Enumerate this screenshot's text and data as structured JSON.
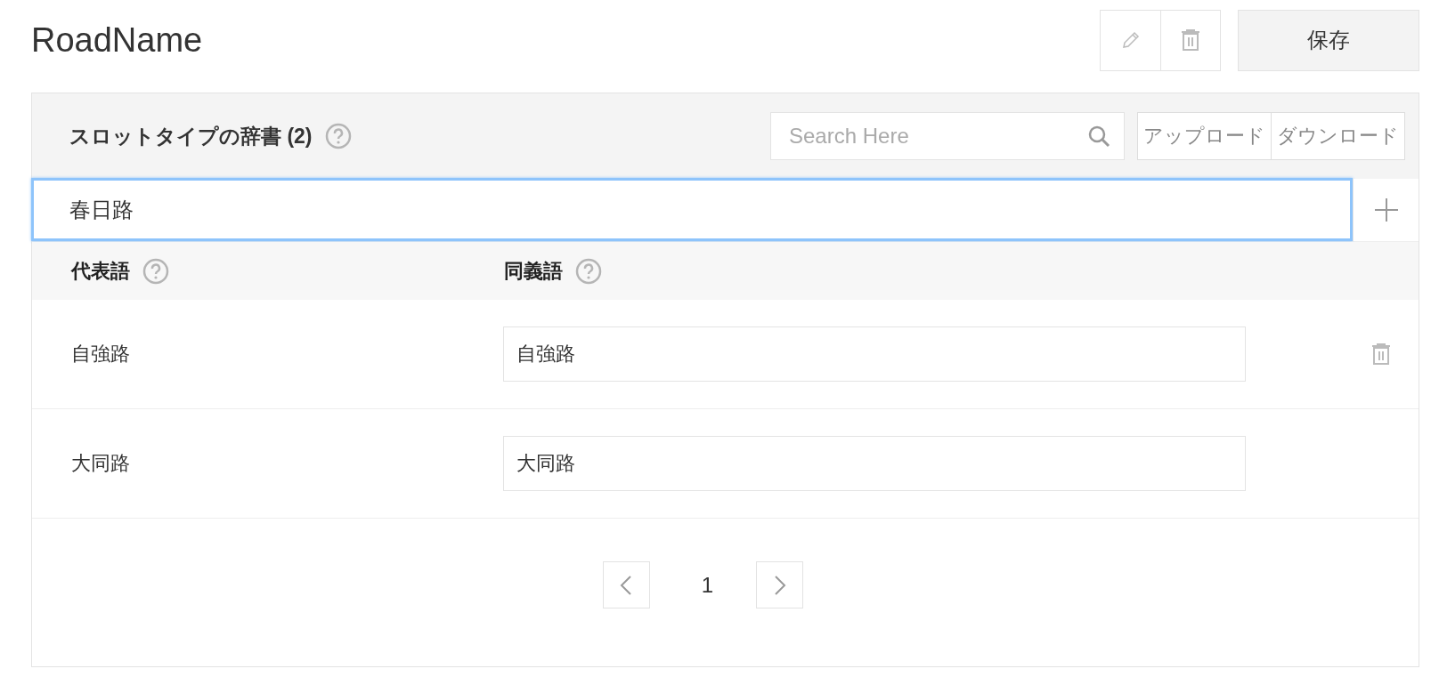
{
  "title": "RoadName",
  "toolbar": {
    "save_label": "保存"
  },
  "dictionary": {
    "heading": "スロットタイプの辞書 (2)",
    "search": {
      "placeholder": "Search Here"
    },
    "upload_label": "アップロード",
    "download_label": "ダウンロード",
    "new_entry": {
      "value": "春日路",
      "focused": true
    },
    "columns": [
      "代表語",
      "同義語"
    ],
    "rows": [
      {
        "representative": "自強路",
        "synonyms": "自強路",
        "hovered": true
      },
      {
        "representative": "大同路",
        "synonyms": "大同路",
        "hovered": false
      }
    ],
    "pagination": {
      "current_page": "1"
    }
  }
}
